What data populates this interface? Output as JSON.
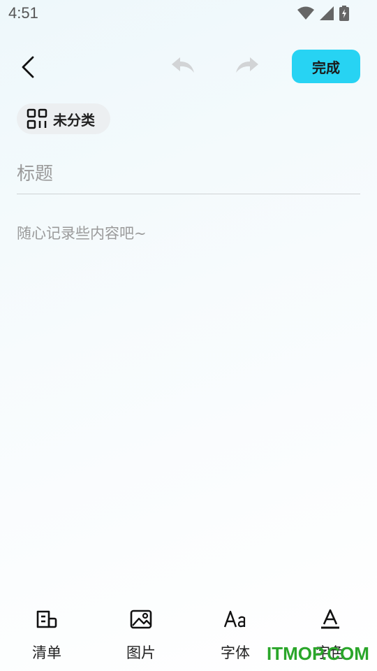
{
  "status_bar": {
    "time": "4:51"
  },
  "toolbar": {
    "done_label": "完成"
  },
  "category": {
    "label": "未分类"
  },
  "editor": {
    "title_placeholder": "标题",
    "content_placeholder": "随心记录些内容吧~"
  },
  "bottom_tools": [
    {
      "label": "清单",
      "icon": "checklist-icon"
    },
    {
      "label": "图片",
      "icon": "image-icon"
    },
    {
      "label": "字体",
      "icon": "font-icon"
    },
    {
      "label": "字色",
      "icon": "text-color-icon"
    }
  ],
  "watermark": {
    "text": "ITMOP.COM"
  },
  "colors": {
    "accent": "#27d3f3",
    "watermark": "#2aa62a"
  }
}
